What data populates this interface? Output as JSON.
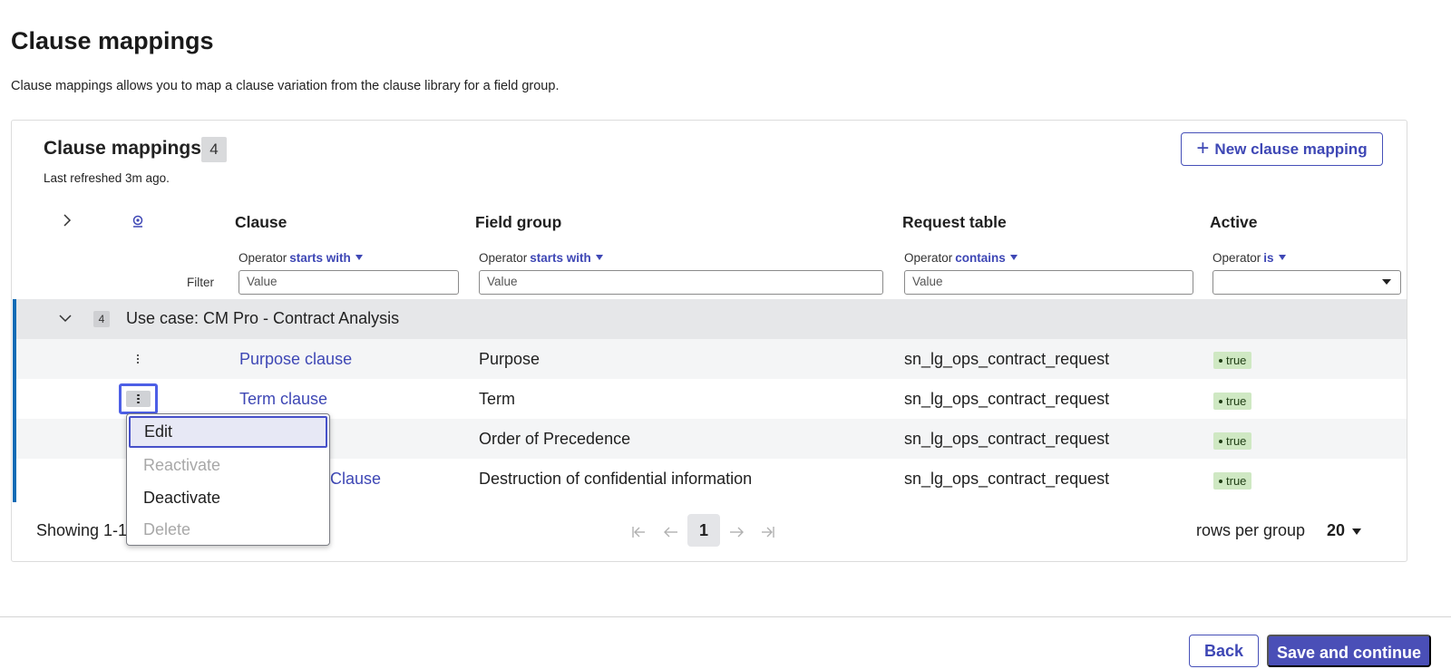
{
  "page": {
    "title": "Clause mappings",
    "description": "Clause mappings allows you to map a clause variation from the clause library for a field group."
  },
  "list": {
    "title": "Clause mappings",
    "count": "4",
    "last_refreshed": "Last refreshed 3m ago.",
    "new_button_label": "New clause mapping",
    "new_button_icon": "plus-icon"
  },
  "columns": [
    {
      "label": "Clause",
      "operator_label": "Operator",
      "operator_value": "starts with",
      "filter_placeholder": "Value"
    },
    {
      "label": "Field group",
      "operator_label": "Operator",
      "operator_value": "starts with",
      "filter_placeholder": "Value"
    },
    {
      "label": "Request table",
      "operator_label": "Operator",
      "operator_value": "contains",
      "filter_placeholder": "Value"
    },
    {
      "label": "Active",
      "operator_label": "Operator",
      "operator_value": "is",
      "filter_value": ""
    }
  ],
  "filter_label": "Filter",
  "group": {
    "count": "4",
    "label": "Use case: CM Pro - Contract Analysis"
  },
  "rows": [
    {
      "clause": "Purpose clause",
      "field_group": "Purpose",
      "request_table": "sn_lg_ops_contract_request",
      "active": "true"
    },
    {
      "clause": "Term clause",
      "field_group": "Term",
      "request_table": "sn_lg_ops_contract_request",
      "active": "true"
    },
    {
      "clause": "",
      "field_group": "Order of Precedence",
      "request_table": "sn_lg_ops_contract_request",
      "active": "true"
    },
    {
      "clause": "Clause",
      "field_group": "Destruction of confidential information",
      "request_table": "sn_lg_ops_contract_request",
      "active": "true"
    }
  ],
  "context_menu": {
    "items": [
      {
        "label": "Edit",
        "state": "active"
      },
      {
        "label": "Reactivate",
        "state": "disabled"
      },
      {
        "label": "Deactivate",
        "state": "enabled"
      },
      {
        "label": "Delete",
        "state": "disabled"
      }
    ]
  },
  "pagination": {
    "showing": "Showing 1-1",
    "current_page": "1",
    "rows_per_group_label": "rows per group",
    "rows_per_group_value": "20"
  },
  "footer": {
    "back_label": "Back",
    "save_label": "Save and continue"
  },
  "colors": {
    "accent": "#3e47b5",
    "primary_button": "#4a4fb7",
    "group_bar": "#0f6bb5",
    "active_pill": "#cfe8c3",
    "focus_ring": "#4d5fe6"
  }
}
